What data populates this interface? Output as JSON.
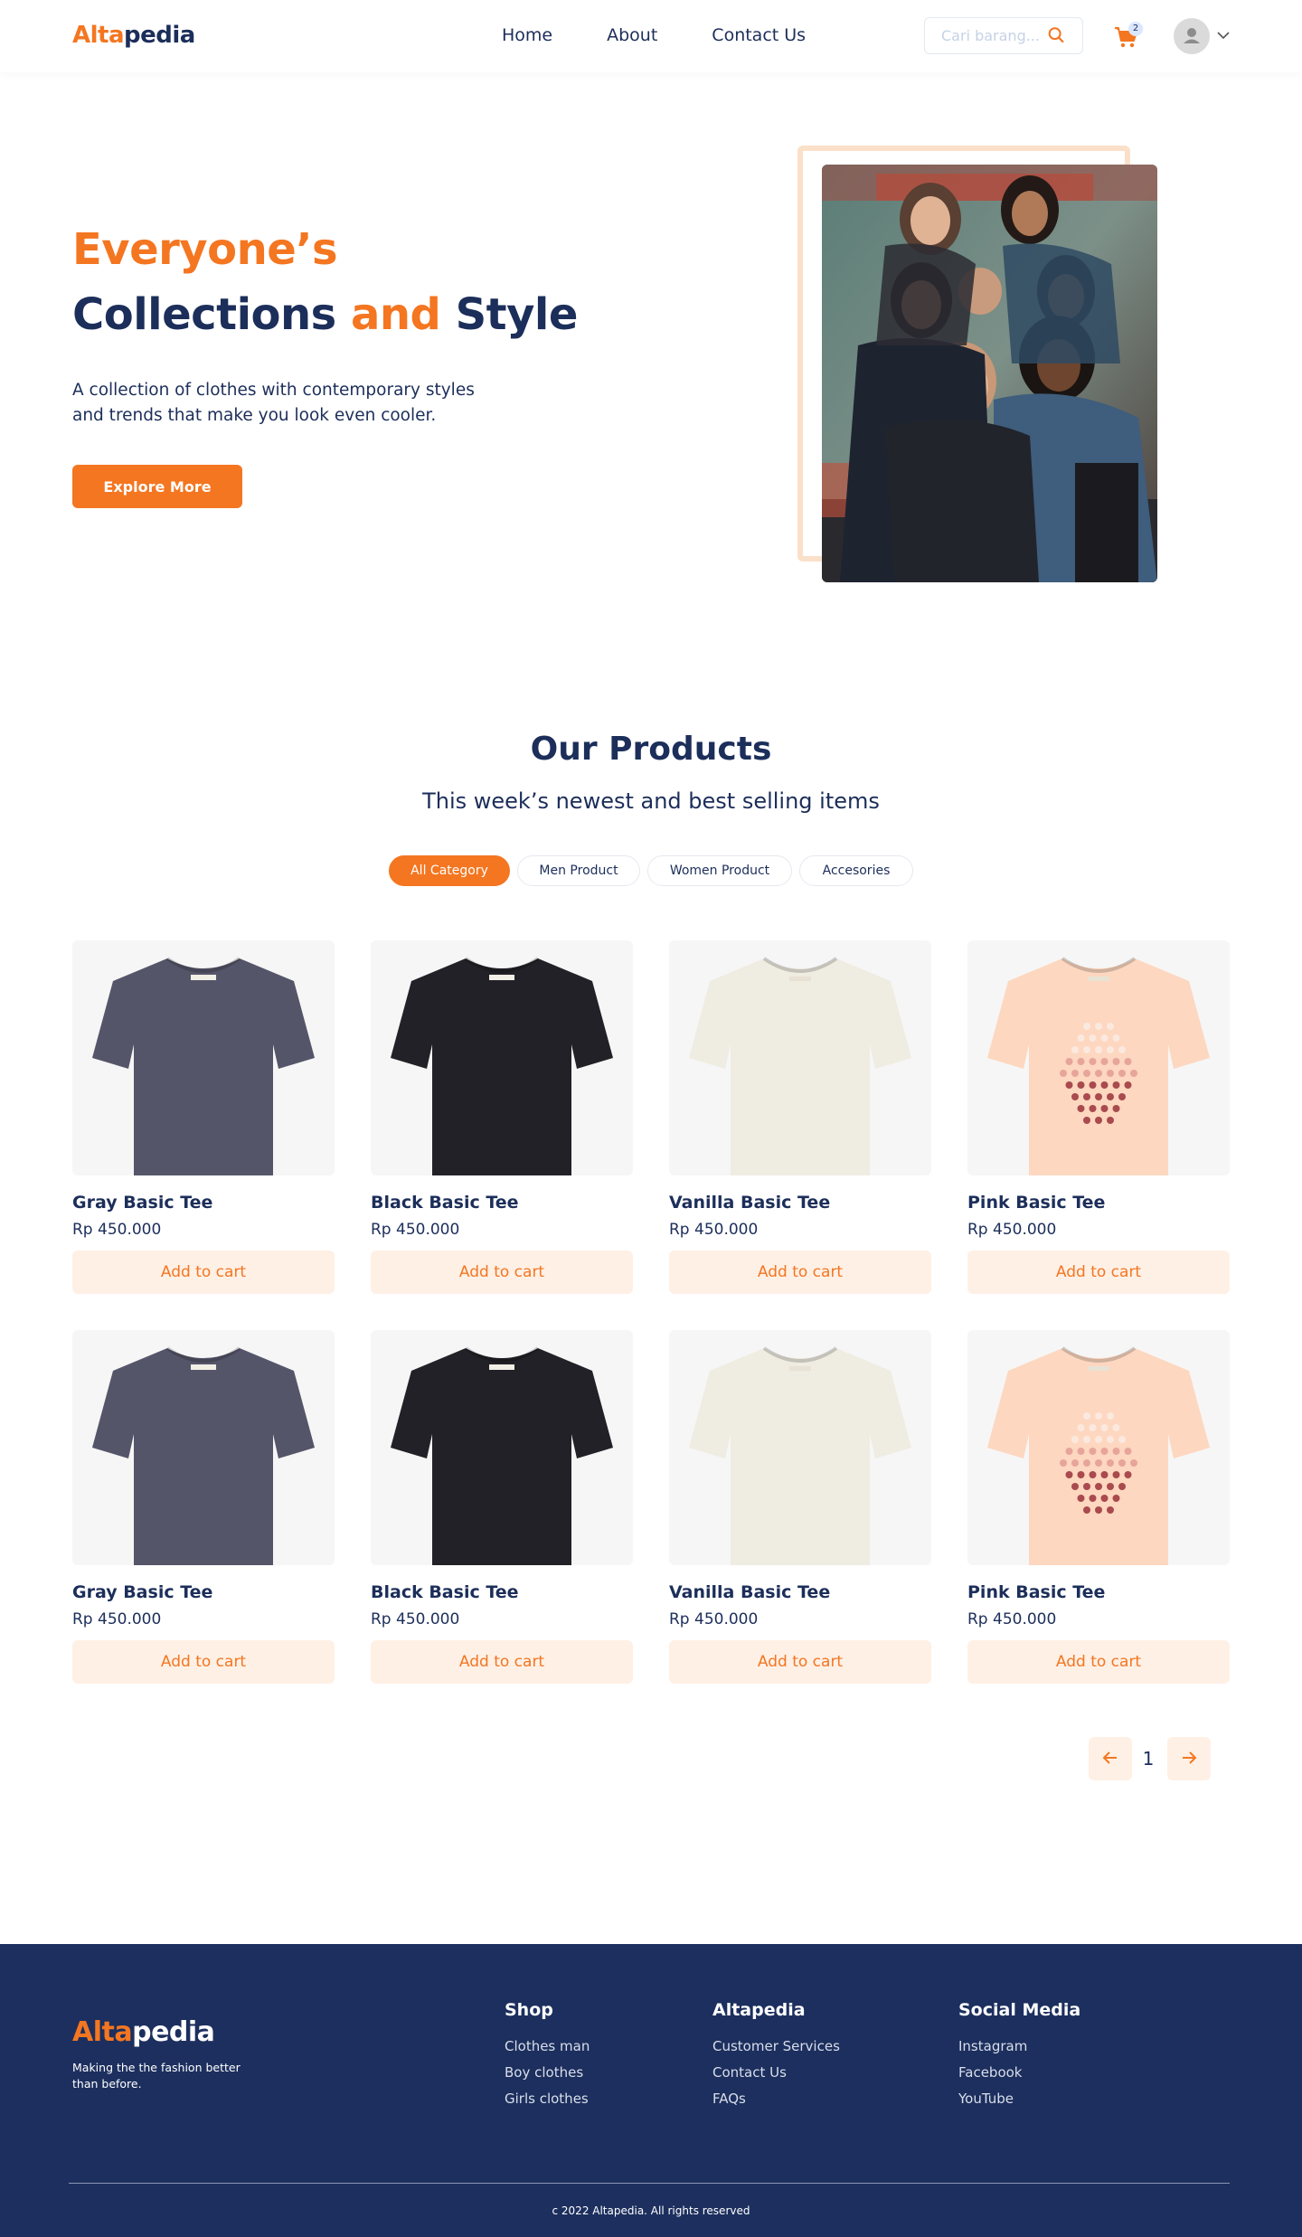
{
  "header": {
    "logo_part1": "Alta",
    "logo_part2": "pedia",
    "nav": [
      "Home",
      "About",
      "Contact Us"
    ],
    "search_placeholder": "Cari barang...",
    "cart_count": "2"
  },
  "hero": {
    "title_line1": "Everyone’s",
    "title_line2_a": "Collections",
    "title_line2_b": "and",
    "title_line2_c": "Style",
    "description": "A collection of clothes with contemporary styles and trends that make you look even cooler.",
    "cta": "Explore More"
  },
  "products": {
    "title": "Our Products",
    "subtitle": "This week’s newest and best selling items",
    "filters": [
      "All Category",
      "Men Product",
      "Women Product",
      "Accesories"
    ],
    "active_filter": 0,
    "add_label": "Add to cart",
    "items": [
      {
        "name": "Gray Basic Tee",
        "price": "Rp 450.000",
        "color": "gray"
      },
      {
        "name": "Black Basic Tee",
        "price": "Rp 450.000",
        "color": "black"
      },
      {
        "name": "Vanilla Basic Tee",
        "price": "Rp 450.000",
        "color": "vanilla"
      },
      {
        "name": "Pink Basic Tee",
        "price": "Rp 450.000",
        "color": "pink"
      },
      {
        "name": "Gray Basic Tee",
        "price": "Rp 450.000",
        "color": "gray"
      },
      {
        "name": "Black Basic Tee",
        "price": "Rp 450.000",
        "color": "black"
      },
      {
        "name": "Vanilla Basic Tee",
        "price": "Rp 450.000",
        "color": "vanilla"
      },
      {
        "name": "Pink Basic Tee",
        "price": "Rp 450.000",
        "color": "pink"
      }
    ],
    "current_page": "1"
  },
  "footer": {
    "logo_part1": "Alta",
    "logo_part2": "pedia",
    "tagline": "Making the the fashion better than before.",
    "columns": [
      {
        "title": "Shop",
        "links": [
          "Clothes man",
          "Boy clothes",
          "Girls clothes"
        ]
      },
      {
        "title": "Altapedia",
        "links": [
          "Customer Services",
          "Contact Us",
          "FAQs"
        ]
      },
      {
        "title": "Social Media",
        "links": [
          "Instagram",
          "Facebook",
          "YouTube"
        ]
      }
    ],
    "copyright": "c 2022 Altapedia. All rights reserved"
  },
  "colors": {
    "accent": "#f47621",
    "navy": "#1c2e5a",
    "footer_bg": "#1c2f5e",
    "button_soft": "#fff0e5",
    "tee_gray": "#55556a",
    "tee_black": "#222127",
    "tee_vanilla": "#efece2",
    "tee_pink": "#fdd7c0"
  }
}
